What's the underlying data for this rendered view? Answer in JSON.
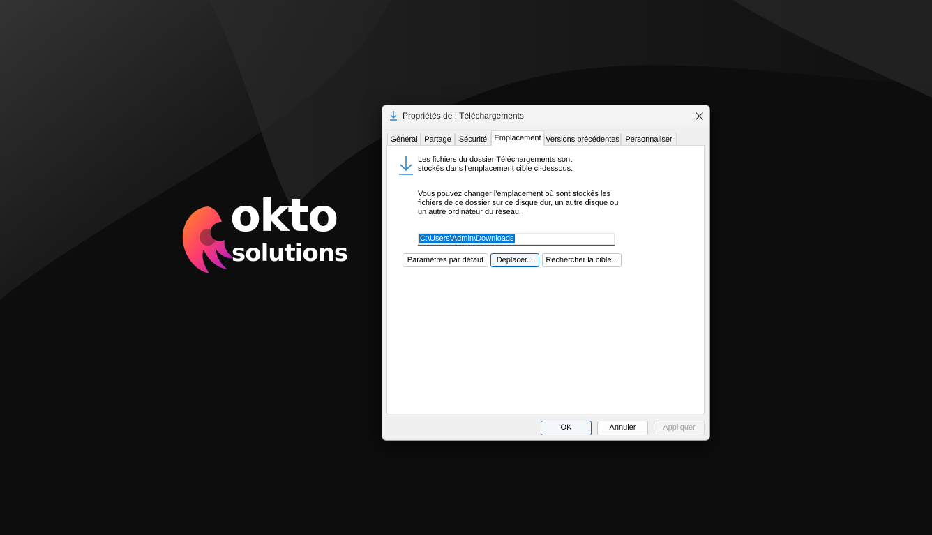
{
  "brand": {
    "word1": "okto",
    "word2": "solutions"
  },
  "dialog": {
    "title": "Propriétés de : Téléchargements",
    "tabs": [
      {
        "label": "Général"
      },
      {
        "label": "Partage"
      },
      {
        "label": "Sécurité"
      },
      {
        "label": "Emplacement",
        "active": true
      },
      {
        "label": "Versions précédentes"
      },
      {
        "label": "Personnaliser"
      }
    ],
    "info_text": "Les fichiers du dossier Téléchargements sont stockés dans l'emplacement cible ci-dessous.",
    "description": "Vous pouvez changer l'emplacement où sont stockés les fichiers de ce dossier sur ce disque dur, un autre disque ou un autre ordinateur du réseau.",
    "path_value": "C:\\Users\\Admin\\Downloads",
    "buttons": {
      "restore_default": "Paramètres par défaut",
      "move": "Déplacer...",
      "find_target": "Rechercher la cible..."
    },
    "footer": {
      "ok": "OK",
      "cancel": "Annuler",
      "apply": "Appliquer"
    }
  },
  "colors": {
    "desktop_bg": "#0e0e0e",
    "accent": "#0067c0",
    "selection": "#0078d7",
    "icon_blue": "#2b88d8"
  },
  "icons": [
    "download-icon",
    "close-icon",
    "okto-flame-logo"
  ]
}
